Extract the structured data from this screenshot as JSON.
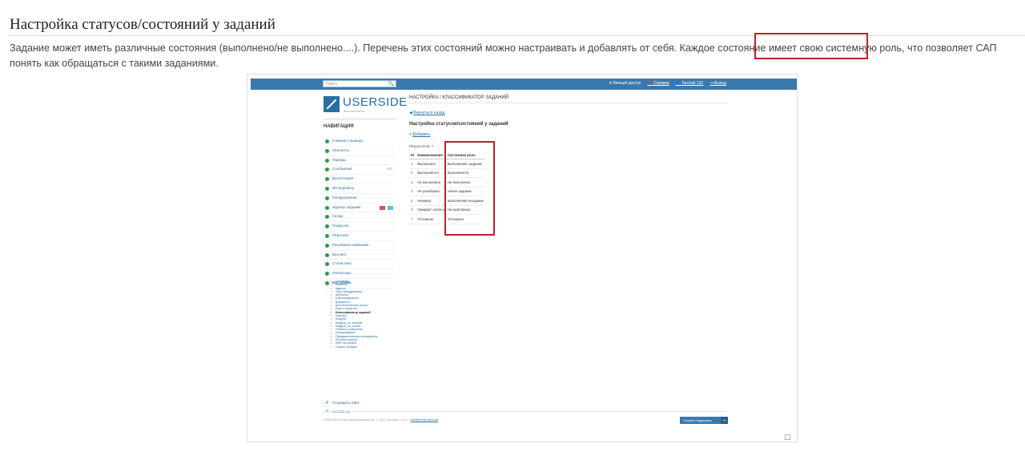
{
  "article": {
    "heading": "Настройка статусов/состояний у заданий",
    "intro": "Задание может иметь различные состояния (выполнено/не выполнено....). Перечень этих состояний можно настраивать и добавлять от себя. Каждое состояние имеет свою системную роль, что позволяет САП понять как обращаться с такими заданиями.",
    "highlight_color": "#b8222b",
    "expand_icon": "□"
  },
  "screenshot": {
    "topbar": {
      "search_placeholder": "Поиск",
      "search_icon": "🔍",
      "links": [
        "♥ Личный доступ",
        "❓ Справка",
        "👤 Tarchak 101",
        "⇥ Выход"
      ]
    },
    "logo": {
      "name": "USERSIDE",
      "tagline": "www.userside.eu"
    },
    "nav": {
      "heading": "НАВИГАЦИЯ",
      "items": [
        {
          "label": "Главная страница"
        },
        {
          "label": "Абоненты"
        },
        {
          "label": "Тарифы"
        },
        {
          "label": "Сообщения",
          "count": "0/0"
        },
        {
          "label": "Бухгалтерия"
        },
        {
          "label": "Интерфейсы"
        },
        {
          "label": "Оборудование"
        },
        {
          "label": "Журнал заданий"
        },
        {
          "label": "Склад"
        },
        {
          "label": "Покрытие"
        },
        {
          "label": "Персонал"
        },
        {
          "label": "Рекламные кампании"
        },
        {
          "label": "Биллинг"
        },
        {
          "label": "Статистика"
        },
        {
          "label": "Операторы"
        },
        {
          "label": "Настройка"
        }
      ],
      "subitems": [
        "Основное",
        "Маркеты",
        "Адреса",
        "Типы оборудования",
        "Биллинги",
        "Благонадежность",
        "Документы",
        "Дополнительные услуги",
        "Карты покрытия",
        "Классификатор заданий",
        "Коробки",
        "Модули",
        "Модуль_us_whitelist",
        "Модуль_us_control",
        "Отметка в обучении",
        "Планирование",
        "Предварительные интерфейсы",
        "Регионы работы",
        "SMS настройка",
        "Список складов"
      ],
      "extra": [
        "Отправить SMS",
        "usersite.ua"
      ]
    },
    "main": {
      "title": "НАСТРОЙКА / КЛАССИФИКАТОР ЗАДАНИЙ",
      "back": "Вернуться назад",
      "section_title": "Настройка статусов/состояний у заданий",
      "add": "Добавить",
      "results": "Результатов: 7",
      "table": {
        "headers": [
          "ID",
          "Наименование",
          "Системная роль"
        ],
        "rows": [
          [
            "1",
            "Выполнено",
            "Выполнение задания"
          ],
          [
            "2",
            "Выполняется",
            "Выполняется"
          ],
          [
            "3",
            "Не выполнено",
            "Не выполнено"
          ],
          [
            "4",
            "Не разобрано",
            "Новое задание"
          ],
          [
            "5",
            "Незавер",
            "Выполнение неодание"
          ],
          [
            "6",
            "Ожидает оплаты",
            "Не выполнено"
          ],
          [
            "7",
            "Отложено",
            "Отложено"
          ]
        ]
      }
    },
    "footer": {
      "copyright": "©2003-2014 http://www.userside.ua",
      "version": "САП userside v.3.6",
      "link": "Изменения версии",
      "support": "Служба поддержки"
    }
  }
}
